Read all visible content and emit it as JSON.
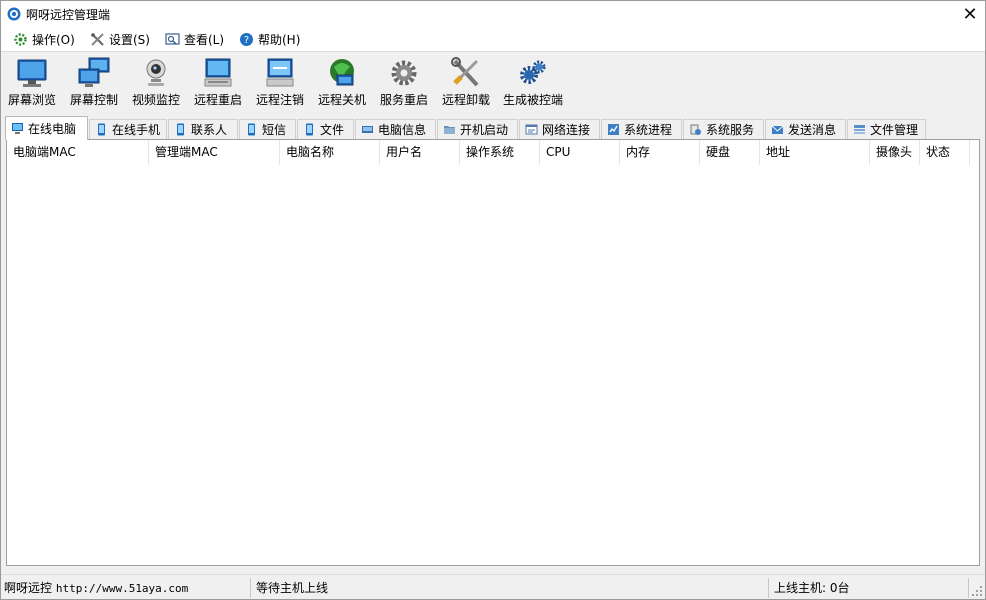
{
  "window": {
    "title": "啊呀远控管理端",
    "close_glyph": "✕"
  },
  "menu": [
    {
      "label": "操作(O)",
      "icon": "operate-icon"
    },
    {
      "label": "设置(S)",
      "icon": "settings-tools-icon"
    },
    {
      "label": "查看(L)",
      "icon": "view-icon"
    },
    {
      "label": "帮助(H)",
      "icon": "help-icon"
    }
  ],
  "toolbar": [
    {
      "label": "屏幕浏览",
      "icon": "monitor-icon"
    },
    {
      "label": "屏幕控制",
      "icon": "screen-control-icon"
    },
    {
      "label": "视频监控",
      "icon": "webcam-icon"
    },
    {
      "label": "远程重启",
      "icon": "restart-icon"
    },
    {
      "label": "远程注销",
      "icon": "logoff-icon"
    },
    {
      "label": "远程关机",
      "icon": "shutdown-icon"
    },
    {
      "label": "服务重启",
      "icon": "gear-icon"
    },
    {
      "label": "远程卸载",
      "icon": "uninstall-tools-icon"
    },
    {
      "label": "生成被控端",
      "icon": "build-gears-icon"
    }
  ],
  "tabs": [
    {
      "label": "在线电脑",
      "icon": "computer-icon",
      "active": true
    },
    {
      "label": "在线手机",
      "icon": "phone-icon",
      "active": false
    },
    {
      "label": "联系人",
      "icon": "phone-icon",
      "active": false
    },
    {
      "label": "短信",
      "icon": "phone-icon",
      "active": false
    },
    {
      "label": "文件",
      "icon": "phone-icon",
      "active": false
    },
    {
      "label": "电脑信息",
      "icon": "pc-info-icon",
      "active": false
    },
    {
      "label": "开机启动",
      "icon": "folder-icon",
      "active": false
    },
    {
      "label": "网络连接",
      "icon": "network-icon",
      "active": false
    },
    {
      "label": "系统进程",
      "icon": "process-icon",
      "active": false
    },
    {
      "label": "系统服务",
      "icon": "service-icon",
      "active": false
    },
    {
      "label": "发送消息",
      "icon": "message-icon",
      "active": false
    },
    {
      "label": "文件管理",
      "icon": "file-manager-icon",
      "active": false
    }
  ],
  "columns": [
    "电脑端MAC",
    "管理端MAC",
    "电脑名称",
    "用户名",
    "操作系统",
    "CPU",
    "内存",
    "硬盘",
    "地址",
    "摄像头",
    "状态"
  ],
  "rows": [],
  "status": {
    "left_label": "啊呀远控",
    "left_url": "http://www.51aya.com",
    "middle": "等待主机上线",
    "right_label": "上线主机:",
    "right_count": "0台"
  },
  "colors": {
    "chrome_bg": "#f0f0f0",
    "accent_blue": "#1f6fc4"
  }
}
